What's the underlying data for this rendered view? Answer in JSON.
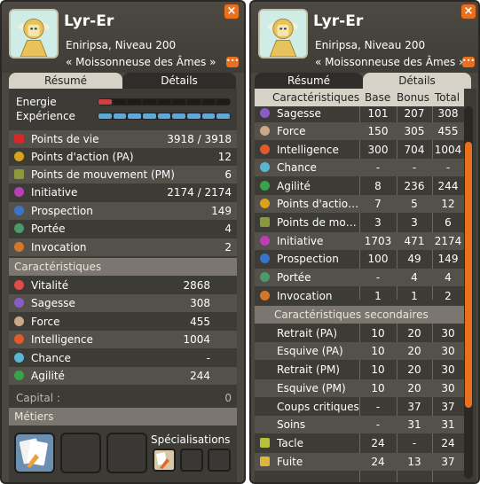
{
  "left": {
    "name": "Lyr-Er",
    "server_level": "Eniripsa, Niveau 200",
    "title": "« Moissonneuse des Âmes »",
    "tabs": [
      "Résumé",
      "Détails"
    ],
    "energy_label": "Energie",
    "experience_label": "Expérience",
    "stats": [
      {
        "label": "Points de vie",
        "value": "3918 / 3918",
        "icon": "heart-icon",
        "color": "#d8262a"
      },
      {
        "label": "Points d'action (PA)",
        "value": "12",
        "icon": "star-icon",
        "color": "#d8a21d"
      },
      {
        "label": "Points de mouvement (PM)",
        "value": "6",
        "icon": "boot-icon",
        "color": "#8a9a3a"
      },
      {
        "label": "Initiative",
        "value": "2174 / 2174",
        "icon": "initiative-icon",
        "color": "#b93fb3"
      },
      {
        "label": "Prospection",
        "value": "149",
        "icon": "prospection-icon",
        "color": "#3b73c9"
      },
      {
        "label": "Portée",
        "value": "4",
        "icon": "range-icon",
        "color": "#4a9a6a"
      },
      {
        "label": "Invocation",
        "value": "2",
        "icon": "invocation-icon",
        "color": "#d2782a"
      }
    ],
    "characteristics_header": "Caractéristiques",
    "characteristics": [
      {
        "label": "Vitalité",
        "value": "2868",
        "icon": "vitality-icon",
        "color": "#e34a4a"
      },
      {
        "label": "Sagesse",
        "value": "308",
        "icon": "wisdom-icon",
        "color": "#8a5cc4"
      },
      {
        "label": "Force",
        "value": "455",
        "icon": "strength-icon",
        "color": "#c9a98a"
      },
      {
        "label": "Intelligence",
        "value": "1004",
        "icon": "intelligence-icon",
        "color": "#e25a2a"
      },
      {
        "label": "Chance",
        "value": "-",
        "icon": "chance-icon",
        "color": "#5bb6d6"
      },
      {
        "label": "Agilité",
        "value": "244",
        "icon": "agility-icon",
        "color": "#3aa24a"
      }
    ],
    "capital_label": "Capital :",
    "capital_value": "0",
    "jobs_header": "Métiers",
    "specializations_label": "Spécialisations"
  },
  "right": {
    "name": "Lyr-Er",
    "server_level": "Eniripsa, Niveau 200",
    "title": "« Moissonneuse des Âmes »",
    "tabs": [
      "Résumé",
      "Détails"
    ],
    "columns": [
      "Caractéristiques",
      "Base",
      "Bonus",
      "Total"
    ],
    "rows": [
      {
        "label": "Sagesse",
        "base": "101",
        "bonus": "207",
        "total": "308",
        "icon": "wisdom-icon",
        "color": "#8a5cc4"
      },
      {
        "label": "Force",
        "base": "150",
        "bonus": "305",
        "total": "455",
        "icon": "strength-icon",
        "color": "#c9a98a"
      },
      {
        "label": "Intelligence",
        "base": "300",
        "bonus": "704",
        "total": "1004",
        "icon": "intelligence-icon",
        "color": "#e25a2a"
      },
      {
        "label": "Chance",
        "base": "-",
        "bonus": "-",
        "total": "-",
        "icon": "chance-icon",
        "color": "#5bb6d6"
      },
      {
        "label": "Agilité",
        "base": "8",
        "bonus": "236",
        "total": "244",
        "icon": "agility-icon",
        "color": "#3aa24a"
      },
      {
        "label": "Points d'actio…",
        "base": "7",
        "bonus": "5",
        "total": "12",
        "icon": "star-icon",
        "color": "#d8a21d"
      },
      {
        "label": "Points de mo…",
        "base": "3",
        "bonus": "3",
        "total": "6",
        "icon": "boot-icon",
        "color": "#8a9a3a"
      },
      {
        "label": "Initiative",
        "base": "1703",
        "bonus": "471",
        "total": "2174",
        "icon": "initiative-icon",
        "color": "#b93fb3"
      },
      {
        "label": "Prospection",
        "base": "100",
        "bonus": "49",
        "total": "149",
        "icon": "prospection-icon",
        "color": "#3b73c9"
      },
      {
        "label": "Portée",
        "base": "-",
        "bonus": "4",
        "total": "4",
        "icon": "range-icon",
        "color": "#4a9a6a"
      },
      {
        "label": "Invocation",
        "base": "1",
        "bonus": "1",
        "total": "2",
        "icon": "invocation-icon",
        "color": "#d2782a"
      }
    ],
    "secondary_header": "Caractéristiques secondaires",
    "secondary_rows": [
      {
        "label": "Retrait (PA)",
        "base": "10",
        "bonus": "20",
        "total": "30"
      },
      {
        "label": "Esquive (PA)",
        "base": "10",
        "bonus": "20",
        "total": "30"
      },
      {
        "label": "Retrait (PM)",
        "base": "10",
        "bonus": "20",
        "total": "30"
      },
      {
        "label": "Esquive (PM)",
        "base": "10",
        "bonus": "20",
        "total": "30"
      },
      {
        "label": "Coups critiques",
        "base": "-",
        "bonus": "37",
        "total": "37"
      },
      {
        "label": "Soins",
        "base": "-",
        "bonus": "31",
        "total": "31"
      },
      {
        "label": "Tacle",
        "base": "24",
        "bonus": "-",
        "total": "24",
        "icon": "tackle-icon",
        "color": "#b7c23a"
      },
      {
        "label": "Fuite",
        "base": "24",
        "bonus": "13",
        "total": "37",
        "icon": "escape-icon",
        "color": "#e0b43a"
      }
    ]
  }
}
